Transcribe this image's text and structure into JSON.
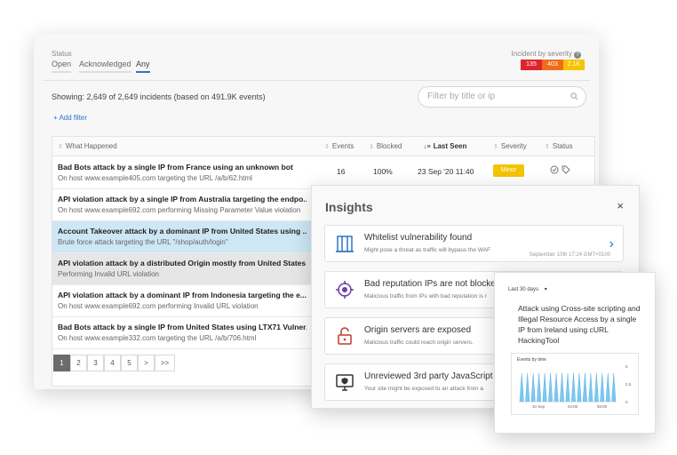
{
  "status": {
    "label": "Status",
    "tabs": [
      {
        "label": "Open",
        "active": false
      },
      {
        "label": "Acknowledged",
        "active": false
      },
      {
        "label": "Any",
        "active": true
      }
    ]
  },
  "severity": {
    "title": "Incident by severity",
    "help_icon": "question-icon",
    "badges": [
      {
        "value": "135",
        "color": "#e0232e"
      },
      {
        "value": "403",
        "color": "#f06b1c"
      },
      {
        "value": "2.1K",
        "color": "#f5c400"
      }
    ]
  },
  "summary": "Showing: 2,649 of 2,649 incidents  (based on 491.9K events)",
  "search": {
    "placeholder": "Filter by title or ip",
    "icon": "search-icon"
  },
  "add_filter": "+ Add filter",
  "table": {
    "headers": [
      "What Happened",
      "Events",
      "Blocked",
      "Last Seen",
      "Severity",
      "Status"
    ],
    "rows": [
      {
        "title": "Bad Bots attack by a single IP from France using an unknown bot",
        "subtitle": "On host www.example405.com targeting the URL /a/b/62.html",
        "events": "16",
        "blocked": "100%",
        "last_seen": "23 Sep '20 11:40",
        "severity": "Minor",
        "status_icons": [
          "check-circle-icon",
          "tag-icon"
        ]
      },
      {
        "title": "API violation attack by a single IP from Australia targeting the endpo...",
        "subtitle": "On host www.example692.com performing Missing Parameter Value violation"
      },
      {
        "title": "Account Takeover attack by a dominant IP from United States using ...",
        "subtitle": "Brute force attack targeting the URL \"/shop/auth/login\"",
        "state": "selected"
      },
      {
        "title": "API violation attack by a distributed Origin mostly from United States",
        "subtitle": "Performing Invalid URL violation",
        "state": "hover"
      },
      {
        "title": "API violation attack by a dominant IP from Indonesia targeting the e...",
        "subtitle": "On host www.example692.com performing Invalid URL violation"
      },
      {
        "title": "Bad Bots attack by a single IP from United States using LTX71 Vulner...",
        "subtitle": "On host www.example332.com targeting the URL /a/b/706.html"
      }
    ]
  },
  "pagination": {
    "pages": [
      "1",
      "2",
      "3",
      "4",
      "5",
      ">",
      ">>"
    ],
    "active": "1"
  },
  "insights": {
    "title": "Insights",
    "close": "×",
    "cards": [
      {
        "title": "Whitelist vulnerability found",
        "subtitle": "Might pose a threat as traffic will bypass the WAF",
        "date": "September 10th 17:24 GMT+0100",
        "icon": "building-icon",
        "has_chevron": true
      },
      {
        "title": "Bad reputation IPs are not blocked",
        "subtitle": "Malicious traffic from IPs with bad reputation is r",
        "icon": "target-icon"
      },
      {
        "title": "Origin servers are exposed",
        "subtitle": "Malicious traffic could reach origin servers.",
        "icon": "unlock-icon"
      },
      {
        "title": "Unreviewed 3rd party JavaScript s",
        "subtitle": "Your site might be exposed to an attack from a",
        "icon": "shield-monitor-icon"
      }
    ],
    "chevron": "›"
  },
  "attack_panel": {
    "range": "Last 30 days",
    "range_caret": "▾",
    "description": "Attack using Cross-site scripting and Illegal Resource Access by a single IP from Ireland using cURL HackingTool",
    "chart_data": {
      "type": "bar",
      "title": "Events by time",
      "x_tick_labels": [
        "10 Sep",
        "04:00",
        "08:00"
      ],
      "y_tick_labels": [
        "5",
        "2.5",
        "0"
      ],
      "ylim": [
        0,
        5
      ],
      "values": [
        4,
        4,
        4,
        4,
        4,
        4,
        4,
        4,
        4,
        4,
        4,
        4,
        4,
        4,
        4,
        4,
        4
      ],
      "color": "#7ec8f0"
    }
  },
  "colors": {
    "accent": "#2f73c9",
    "selected_row": "#cde7f5",
    "minor": "#f5c400"
  }
}
